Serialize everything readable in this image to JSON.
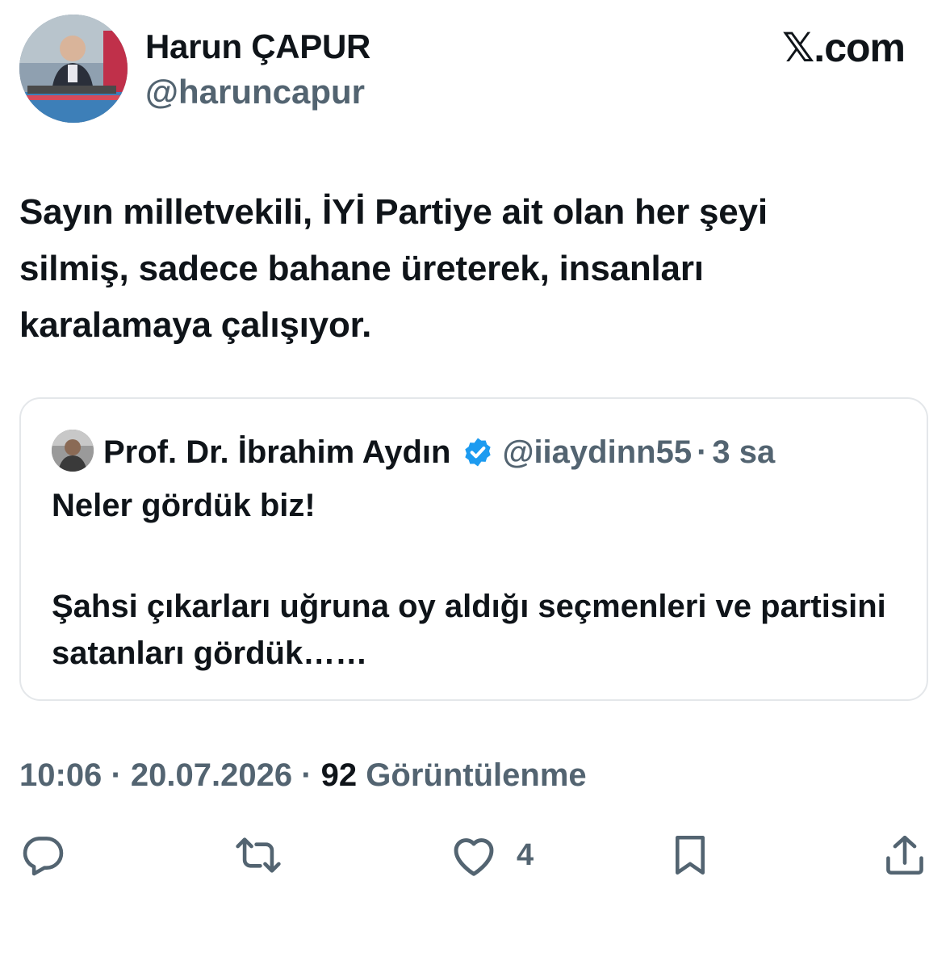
{
  "author": {
    "name": "Harun ÇAPUR",
    "handle": "@haruncapur"
  },
  "brand": "𝕏.com",
  "tweet": {
    "lines": [
      "Sayın milletvekili, İYİ Partiye ait olan her şeyi",
      "silmiş, sadece bahane üreterek, insanları",
      "karalamaya çalışıyor."
    ]
  },
  "quote": {
    "name": "Prof. Dr. İbrahim Aydın",
    "handle": "@iiaydinn55",
    "separator": "·",
    "time": "3 sa",
    "line1": "Neler gördük biz!",
    "line2": "Şahsi çıkarları uğruna oy aldığı seçmenleri ve partisini satanları gördük……"
  },
  "meta": {
    "time": "10:06",
    "separator": "·",
    "date": "20.07.2026",
    "views_count": "92",
    "views_label": "Görüntülenme"
  },
  "actions": {
    "reply_icon": "reply-icon",
    "repost_icon": "repost-icon",
    "like_icon": "heart-icon",
    "like_count": "4",
    "bookmark_icon": "bookmark-icon",
    "share_icon": "share-icon"
  },
  "colors": {
    "text": "#0f1419",
    "secondary": "#536471",
    "border": "#e4e7ea",
    "verified": "#1d9bf0"
  }
}
